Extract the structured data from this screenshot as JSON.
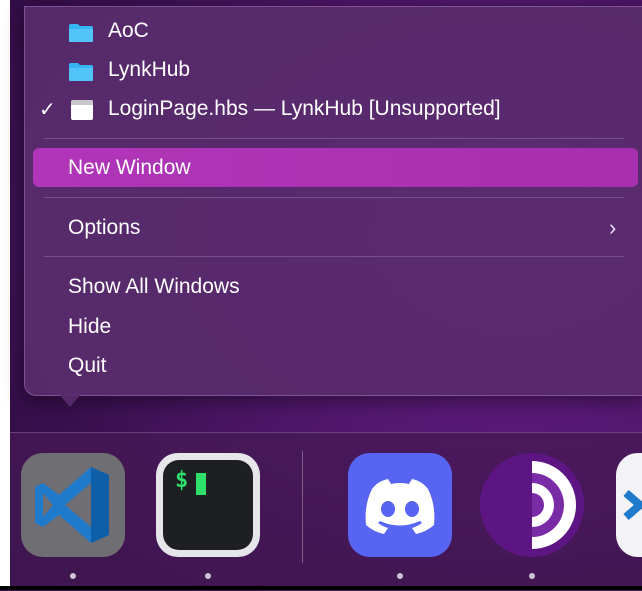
{
  "window_list": [
    {
      "label": "AoC",
      "icon": "folder-icon"
    },
    {
      "label": "LynkHub",
      "icon": "folder-icon"
    },
    {
      "label": "LoginPage.hbs — LynkHub [Unsupported]",
      "icon": "document-icon",
      "checked": true,
      "check_mark": "✓"
    }
  ],
  "menu": {
    "new_window": "New Window",
    "options": "Options",
    "options_chevron": "›",
    "show_all_windows": "Show All Windows",
    "hide": "Hide",
    "quit": "Quit"
  },
  "dock": {
    "apps": [
      {
        "name": "Visual Studio Code",
        "icon": "vscode-icon",
        "running": true
      },
      {
        "name": "Terminal",
        "icon": "terminal-icon",
        "running": true,
        "prompt": "$"
      },
      {
        "name": "Discord",
        "icon": "discord-icon",
        "running": true
      },
      {
        "name": "Tor Browser",
        "icon": "tor-icon",
        "running": true
      },
      {
        "name": "partial-app",
        "icon": "app-icon",
        "running": false
      }
    ]
  },
  "colors": {
    "highlight": "#b035b8",
    "menu_bg": "#582c6c",
    "wallpaper": "#5a1a78"
  }
}
